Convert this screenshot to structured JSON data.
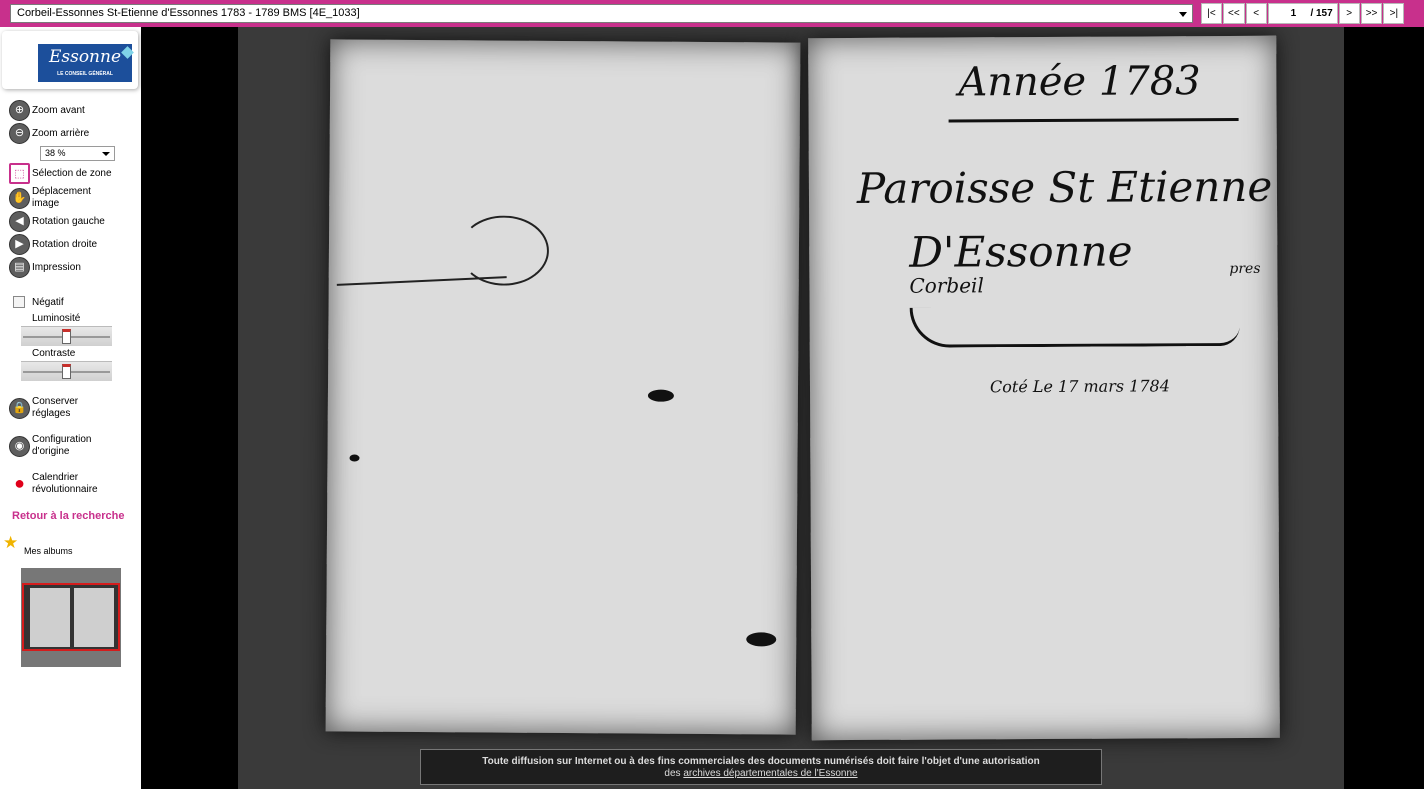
{
  "topbar": {
    "document_title": "Corbeil-Essonnes St-Etienne d'Essonnes 1783 - 1789 BMS [4E_1033]",
    "nav_first": "|<",
    "nav_prev_fast": "<<",
    "nav_prev": "<",
    "page_current": "1",
    "page_total": "/ 157",
    "nav_next": ">",
    "nav_next_fast": ">>",
    "nav_last": ">|"
  },
  "logo": {
    "name": "Essonne",
    "subtitle": "LE CONSEIL GÉNÉRAL"
  },
  "tools": {
    "zoom_in": "Zoom avant",
    "zoom_out": "Zoom arrière",
    "zoom_level": "38 %",
    "area_select": "Sélection de zone",
    "pan": "Déplacement image",
    "rotate_left": "Rotation gauche",
    "rotate_right": "Rotation droite",
    "print": "Impression",
    "negative": "Négatif",
    "brightness": "Luminosité",
    "contrast": "Contraste",
    "save_settings": "Conserver réglages",
    "reset": "Configuration d'origine",
    "calendar": "Calendrier révolutionnaire"
  },
  "adjustments": {
    "negative_checked": false,
    "brightness_level": 0.5,
    "contrast_level": 0.5
  },
  "back_link": "Retour à la recherche",
  "albums_label": "Mes albums",
  "icons": {
    "zoom_in": "zoom-in-icon",
    "zoom_out": "zoom-out-icon",
    "area_select": "selection-icon",
    "pan": "hand-icon",
    "rotate_left": "rotate-left-icon",
    "rotate_right": "rotate-right-icon",
    "print": "printer-icon",
    "save_settings": "lock-icon",
    "reset": "eye-icon",
    "calendar": "phrygian-cap-icon",
    "albums": "star-icon"
  },
  "colors": {
    "accent": "#c8308c",
    "logo_blue": "#1c4f9b",
    "viewer_bg": "#000000"
  },
  "manuscript": {
    "year": "Année 1783",
    "parish_line1": "Paroisse St Etienne",
    "parish_line2": "D'Essonne",
    "parish_near": "Corbeil",
    "parish_pres": "pres",
    "signed": "Coté Le 17 mars 1784"
  },
  "notice": {
    "line1": "Toute diffusion sur Internet ou à des fins commerciales des documents numérisés doit faire l'objet d'une autorisation",
    "line2_prefix": "des",
    "link": "archives départementales de l'Essonne"
  }
}
